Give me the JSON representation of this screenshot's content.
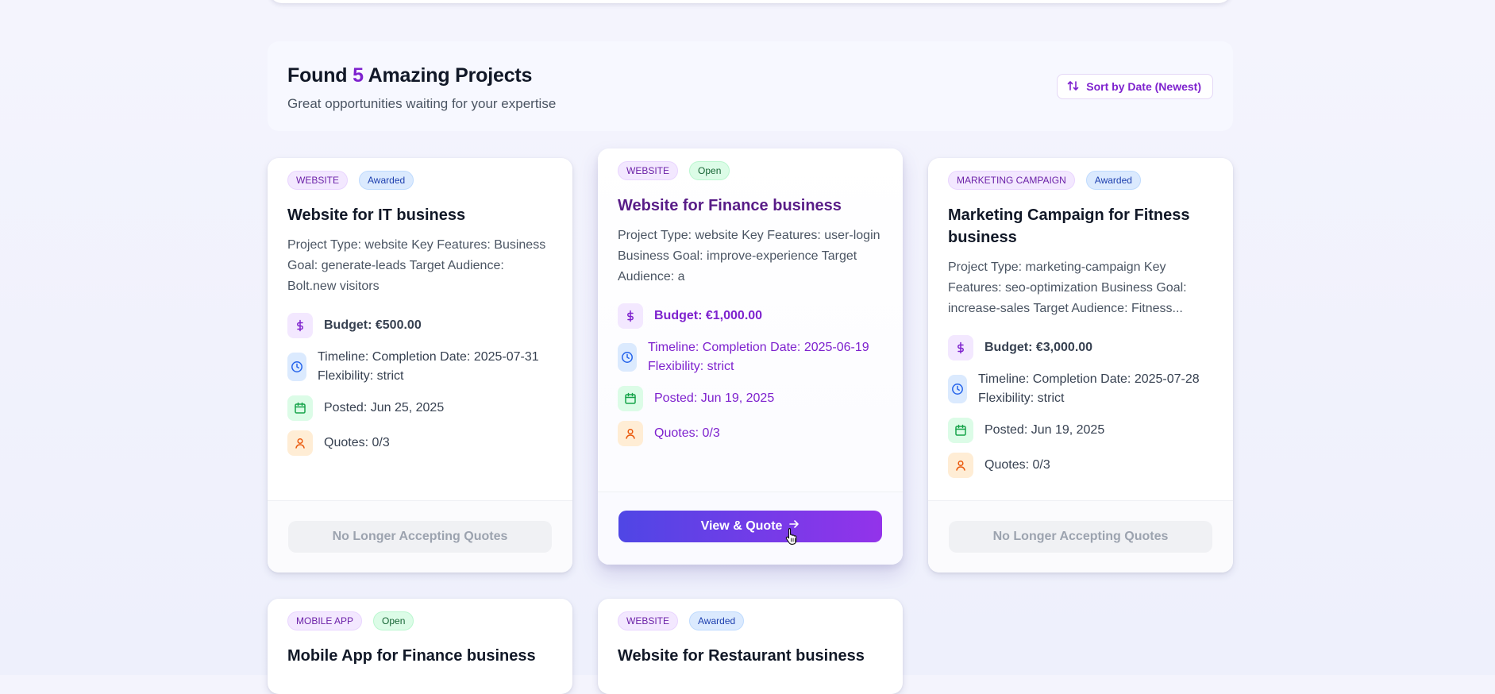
{
  "header": {
    "title_prefix": "Found",
    "count": "5",
    "title_suffix": "Amazing Projects",
    "subtitle": "Great opportunities waiting for your expertise",
    "sort_label": "Sort by Date (Newest)"
  },
  "colors": {
    "accent": "#7e22ce",
    "primary_gradient_start": "#4f46e5",
    "primary_gradient_end": "#9333ea"
  },
  "cards": [
    {
      "type": "WEBSITE",
      "status": "Awarded",
      "title": "Website for IT business",
      "description": "Project Type: website Key Features: Business Goal: generate-leads Target Audience: Bolt.new visitors",
      "budget": "Budget: €500.00",
      "timeline": "Timeline: Completion Date: 2025-07-31 Flexibility: strict",
      "posted": "Posted: Jun 25, 2025",
      "quotes": "Quotes: 0/3",
      "action": "No Longer Accepting Quotes"
    },
    {
      "type": "WEBSITE",
      "status": "Open",
      "title": "Website for Finance business",
      "description": "Project Type: website Key Features: user-login Business Goal: improve-experience Target Audience: a",
      "budget": "Budget: €1,000.00",
      "timeline": "Timeline: Completion Date: 2025-06-19 Flexibility: strict",
      "posted": "Posted: Jun 19, 2025",
      "quotes": "Quotes: 0/3",
      "action": "View & Quote"
    },
    {
      "type": "MARKETING CAMPAIGN",
      "status": "Awarded",
      "title": "Marketing Campaign for Fitness business",
      "description": "Project Type: marketing-campaign Key Features: seo-optimization Business Goal: increase-sales Target Audience: Fitness...",
      "budget": "Budget: €3,000.00",
      "timeline": "Timeline: Completion Date: 2025-07-28 Flexibility: strict",
      "posted": "Posted: Jun 19, 2025",
      "quotes": "Quotes: 0/3",
      "action": "No Longer Accepting Quotes"
    },
    {
      "type": "MOBILE APP",
      "status": "Open",
      "title": "Mobile App for Finance business"
    },
    {
      "type": "WEBSITE",
      "status": "Awarded",
      "title": "Website for Restaurant business"
    }
  ]
}
